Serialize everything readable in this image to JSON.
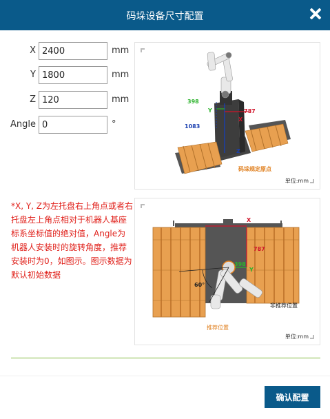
{
  "dialog": {
    "title": "码垛设备尺寸配置"
  },
  "fields": [
    {
      "label": "X",
      "value": "2400",
      "unit": "mm"
    },
    {
      "label": "Y",
      "value": "1800",
      "unit": "mm"
    },
    {
      "label": "Z",
      "value": "120",
      "unit": "mm"
    },
    {
      "label": "Angle",
      "value": "0",
      "unit": "°"
    }
  ],
  "note": "*X, Y, Z为左托盘右上角点或者右托盘左上角点相对于机器人基座标系坐标值的绝对值，Angle为机器人安装时的旋转角度，推荐安装时为0，如图示。图示数据为默认初始数据",
  "diagram1": {
    "dim_y": "398",
    "dim_x": "787",
    "dim_z": "1083",
    "axis_y": "Y",
    "axis_x": "X",
    "axis_z": "Z",
    "origin_label": "码垛规定原点",
    "unit_label": "单位:mm"
  },
  "diagram2": {
    "axis_x": "X",
    "dim_x": "787",
    "dim_y": "398",
    "axis_y": "Y",
    "angle": "60°",
    "not_recommended": "非推荐位置",
    "recommended": "推荐位置",
    "unit_label": "单位:mm"
  },
  "footer": {
    "confirm_label": "确认配置"
  },
  "colors": {
    "header": "#0a5a8a",
    "note_text": "#e0201a",
    "divider": "#7fb83a",
    "pallet": "#e8a050",
    "frame": "#555555"
  }
}
